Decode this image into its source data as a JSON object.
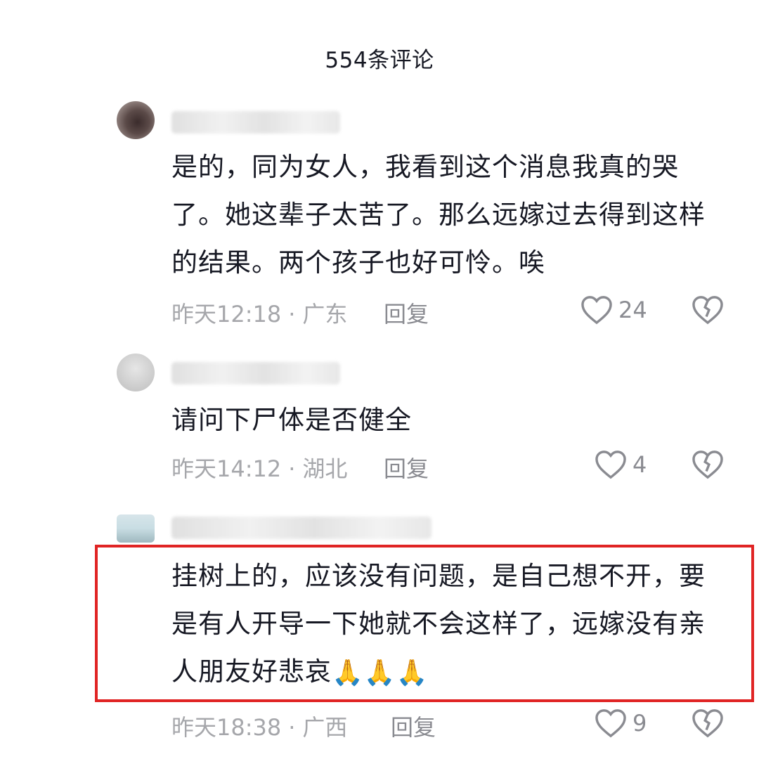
{
  "header": {
    "title": "554条评论"
  },
  "comments": [
    {
      "text": "是的，同为女人，我看到这个消息我真的哭了。她这辈子太苦了。那么远嫁过去得到这样的结果。两个孩子也好可怜。唉",
      "time": "昨天12:18",
      "separator": "·",
      "location": "广东",
      "reply_label": "回复",
      "likes": "24"
    },
    {
      "text": "请问下尸体是否健全",
      "time": "昨天14:12",
      "separator": "·",
      "location": "湖北",
      "reply_label": "回复",
      "likes": "4"
    },
    {
      "text": "挂树上的，应该没有问题，是自己想不开，要是有人开导一下她就不会这样了，远嫁没有亲人朋友好悲哀",
      "emoji": "🙏🙏🙏",
      "time": "昨天18:38",
      "separator": "·",
      "location": "广西",
      "reply_label": "回复",
      "likes": "9"
    }
  ],
  "icons": {
    "like": "heart-outline-icon",
    "dislike": "broken-heart-icon"
  },
  "colors": {
    "highlight_border": "#e02424",
    "meta_text": "#a6a7ab"
  }
}
